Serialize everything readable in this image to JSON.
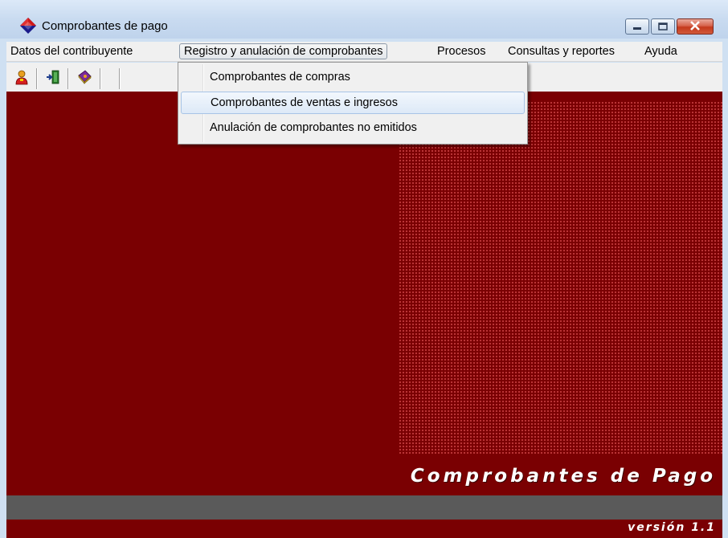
{
  "window": {
    "title": "Comprobantes de pago",
    "controls": [
      "minimize-icon",
      "maximize-icon",
      "close-icon"
    ]
  },
  "menubar": {
    "items": [
      {
        "label": "Datos del contribuyente"
      },
      {
        "label": "Registro y anulación de comprobantes",
        "active": true
      },
      {
        "label": "Procesos"
      },
      {
        "label": "Consultas y reportes"
      },
      {
        "label": "Ayuda"
      }
    ]
  },
  "toolbar": {
    "buttons": [
      "user-icon",
      "exit-door-icon",
      "book-icon"
    ]
  },
  "dropdown": {
    "items": [
      {
        "label": "Comprobantes de compras"
      },
      {
        "label": "Comprobantes de ventas e ingresos",
        "highlighted": true
      },
      {
        "label": "Anulación de comprobantes no emitidos"
      }
    ]
  },
  "main": {
    "brand_title": "Comprobantes de Pago",
    "version": "versión 1.1"
  },
  "colors": {
    "background": "#7a0002",
    "band": "#5a5a5a",
    "menu": "#f0f0f0"
  }
}
